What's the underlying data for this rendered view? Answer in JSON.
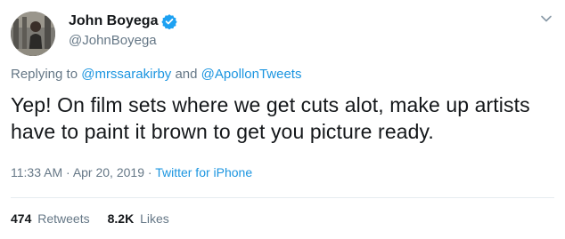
{
  "author": {
    "display_name": "John Boyega",
    "handle": "@JohnBoyega",
    "verified": true
  },
  "reply": {
    "prefix": "Replying to",
    "mention_1": "@mrssarakirby",
    "conjunction": "and",
    "mention_2": "@ApollonTweets"
  },
  "tweet": {
    "text": "Yep! On film sets where we get cuts alot, make up artists have to paint it brown to get you picture ready.",
    "time": "11:33 AM",
    "date": "Apr 20, 2019",
    "separator": "·",
    "source": "Twitter for iPhone"
  },
  "stats": {
    "retweets_count": "474",
    "retweets_label": "Retweets",
    "likes_count": "8.2K",
    "likes_label": "Likes"
  },
  "colors": {
    "link": "#1b95e0",
    "secondary_text": "#657786",
    "verified_badge": "#1da1f2"
  },
  "icons": {
    "verified": "verified-badge-icon",
    "menu": "chevron-down-icon"
  }
}
